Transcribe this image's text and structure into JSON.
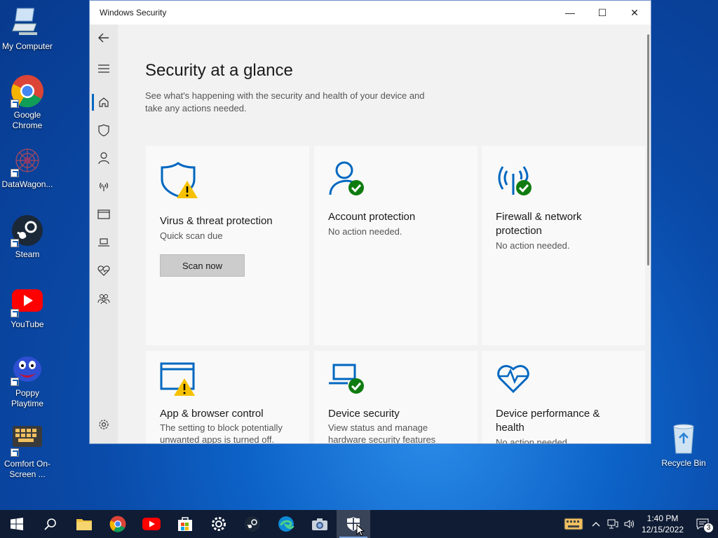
{
  "desktop": {
    "icons": [
      {
        "label": "My Computer"
      },
      {
        "label": "Google Chrome"
      },
      {
        "label": "DataWagon..."
      },
      {
        "label": "Steam"
      },
      {
        "label": "YouTube"
      },
      {
        "label": "Poppy Playtime"
      },
      {
        "label": "Comfort On-Screen ..."
      },
      {
        "label": "Recycle Bin"
      }
    ]
  },
  "window": {
    "title": "Windows Security",
    "controls": {
      "minimize": "—",
      "maximize": "☐",
      "close": "✕"
    }
  },
  "nav": {
    "items": [
      {
        "name": "back-arrow-icon"
      },
      {
        "name": "menu-icon"
      },
      {
        "name": "home-icon"
      },
      {
        "name": "shield-icon"
      },
      {
        "name": "person-icon"
      },
      {
        "name": "network-icon"
      },
      {
        "name": "app-browser-icon"
      },
      {
        "name": "laptop-icon"
      },
      {
        "name": "heart-pulse-icon"
      },
      {
        "name": "family-icon"
      },
      {
        "name": "settings-gear-icon"
      }
    ]
  },
  "main": {
    "heading": "Security at a glance",
    "subtitle": "See what's happening with the security and health of your device and take any actions needed.",
    "tiles": [
      {
        "title": "Virus & threat protection",
        "desc": "Quick scan due",
        "button": "Scan now",
        "status": "warning"
      },
      {
        "title": "Account protection",
        "desc": "No action needed.",
        "status": "ok"
      },
      {
        "title": "Firewall & network protection",
        "desc": "No action needed.",
        "status": "ok"
      },
      {
        "title": "App & browser control",
        "desc": "The setting to block potentially unwanted apps is turned off.",
        "status": "warning"
      },
      {
        "title": "Device security",
        "desc": "View status and manage hardware security features",
        "status": "ok"
      },
      {
        "title": "Device performance & health",
        "desc": "No action needed.",
        "status": "ok"
      }
    ]
  },
  "colors": {
    "accent": "#0067c0",
    "ok": "#107c10",
    "warning": "#f6c100"
  },
  "taskbar": {
    "apps": [
      "start-icon",
      "search-icon",
      "file-explorer-icon",
      "chrome-icon",
      "youtube-icon",
      "store-icon",
      "settings-icon",
      "steam-icon",
      "edge-icon",
      "camera-icon",
      "windows-security-icon"
    ],
    "time": "1:40 PM",
    "date": "12/15/2022",
    "notifications": "3"
  }
}
